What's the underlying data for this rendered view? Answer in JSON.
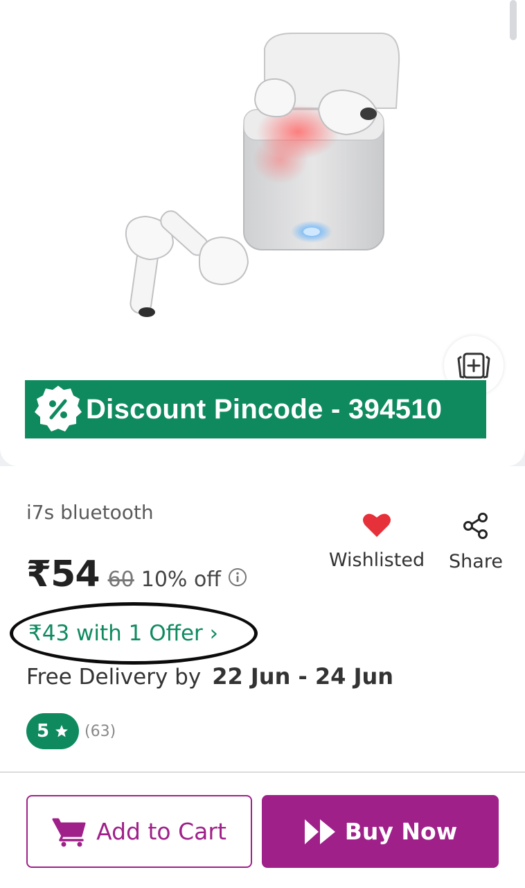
{
  "product": {
    "image_alt": "earbuds",
    "banner_text": "Discount Pincode - 394510",
    "name": "i7s bluetooth"
  },
  "price": {
    "current": "₹54",
    "mrp": "60",
    "discount": "10% off"
  },
  "actions": {
    "wishlist_label": "Wishlisted",
    "share_label": "Share"
  },
  "offer": {
    "text": "₹43 with 1 Offer ›"
  },
  "delivery": {
    "label": "Free Delivery by",
    "dates": "22 Jun - 24 Jun"
  },
  "rating": {
    "value": "5",
    "count": "(63)"
  },
  "buttons": {
    "add_to_cart": "Add to Cart",
    "buy_now": "Buy Now"
  },
  "icons": [
    "compare-icon",
    "percent-badge-icon",
    "info-icon",
    "heart-icon",
    "share-icon",
    "star-icon",
    "cart-icon",
    "fast-forward-icon"
  ],
  "colors": {
    "brand": "#9f2089",
    "green": "#0f8a5f",
    "heart": "#e6303a"
  }
}
